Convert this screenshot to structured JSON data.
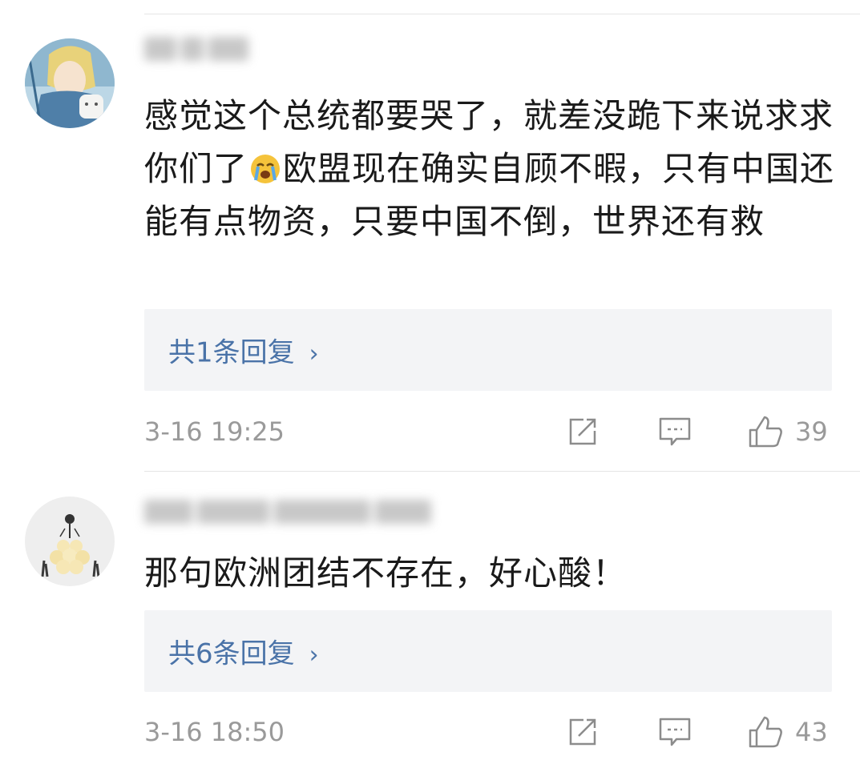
{
  "comments": [
    {
      "text": "感觉这个总统都要哭了，就差没跪下来说求求你们了",
      "text_after_emoji": "欧盟现在确实自顾不暇，只有中国还能有点物资，只要中国不倒，世界还有救",
      "emoji": "crying-face",
      "replies_label": "共1条回复",
      "time": "3-16 19:25",
      "likes": "39",
      "avatar": "anime-character-with-cat"
    },
    {
      "text": "那句欧洲团结不存在，好心酸！",
      "replies_label": "共6条回复",
      "time": "3-16 18:50",
      "likes": "43",
      "avatar": "flower-dress-illustration"
    }
  ],
  "colors": {
    "reply_link": "#4a73a8",
    "meta_gray": "#9a9a9a",
    "reply_bg": "#f3f4f6"
  },
  "icons": [
    "repost-icon",
    "comment-icon",
    "like-icon",
    "chevron-right-icon"
  ]
}
